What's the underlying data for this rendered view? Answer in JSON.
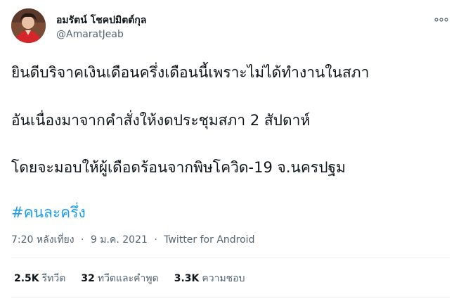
{
  "author": {
    "display_name": "อมรัตน์ โชคปมิตต์กุล",
    "handle": "@AmaratJeab",
    "avatar_icon": "profile-photo"
  },
  "more_icon": "more-horizontal-icon",
  "tweet": {
    "lines": [
      "ยินดีบริจาคเงินเดือนครึ่งเดือนนี้เพราะไม่ได้ทำงานในสภา",
      "อันเนื่องมาจากคำสั่งให้งดประชุมสภา 2 สัปดาห์",
      "โดยจะมอบให้ผู้เดือดร้อนจากพิษโควิด-19 จ.นครปฐม"
    ],
    "hashtag": "#คนละครึ่ง",
    "time": "7:20 หลังเที่ยง",
    "separator": "·",
    "date": "9 ม.ค. 2021",
    "source": "Twitter for Android"
  },
  "stats": {
    "retweets": {
      "count": "2.5K",
      "label": "รีทวีต"
    },
    "quotes": {
      "count": "32",
      "label": "ทวีตและคำพูด"
    },
    "likes": {
      "count": "3.3K",
      "label": "ความชอบ"
    }
  },
  "colors": {
    "link": "#1d9bf0",
    "text": "#0f1419",
    "secondary": "#536471",
    "divider": "#eff3f4"
  }
}
